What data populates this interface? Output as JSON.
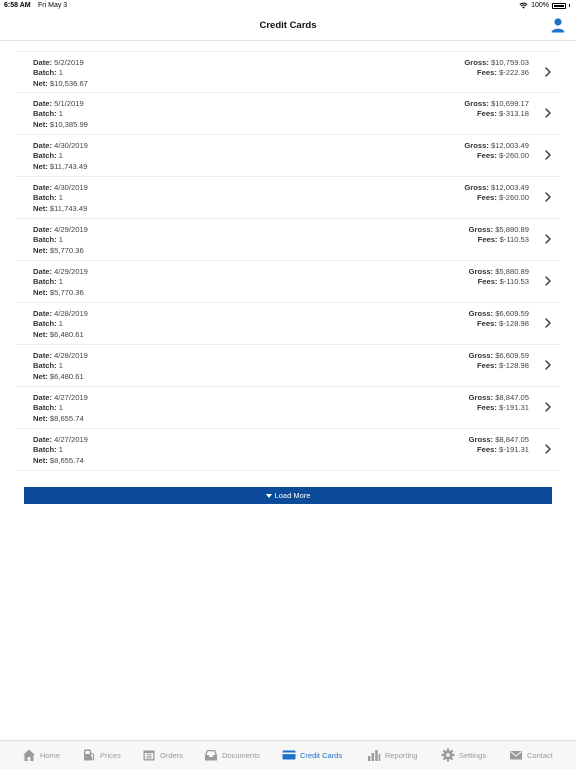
{
  "status": {
    "time": "6:58 AM",
    "date": "Fri May 3",
    "battery": "100%"
  },
  "nav": {
    "title": "Credit Cards"
  },
  "labels": {
    "date": "Date:",
    "batch": "Batch:",
    "net": "Net:",
    "gross": "Gross:",
    "fees": "Fees:"
  },
  "rows": [
    {
      "date": "5/2/2019",
      "batch": "1",
      "net": "$10,536.67",
      "gross": "$10,759.03",
      "fees": "$-222.36"
    },
    {
      "date": "5/1/2019",
      "batch": "1",
      "net": "$10,385.99",
      "gross": "$10,699.17",
      "fees": "$-313.18"
    },
    {
      "date": "4/30/2019",
      "batch": "1",
      "net": "$11,743.49",
      "gross": "$12,003.49",
      "fees": "$-260.00"
    },
    {
      "date": "4/30/2019",
      "batch": "1",
      "net": "$11,743.49",
      "gross": "$12,003.49",
      "fees": "$-260.00"
    },
    {
      "date": "4/29/2019",
      "batch": "1",
      "net": "$5,770.36",
      "gross": "$5,880.89",
      "fees": "$-110.53"
    },
    {
      "date": "4/29/2019",
      "batch": "1",
      "net": "$5,770.36",
      "gross": "$5,880.89",
      "fees": "$-110.53"
    },
    {
      "date": "4/28/2019",
      "batch": "1",
      "net": "$6,480.61",
      "gross": "$6,609.59",
      "fees": "$-128.98"
    },
    {
      "date": "4/28/2019",
      "batch": "1",
      "net": "$6,480.61",
      "gross": "$6,609.59",
      "fees": "$-128.98"
    },
    {
      "date": "4/27/2019",
      "batch": "1",
      "net": "$8,655.74",
      "gross": "$8,847.05",
      "fees": "$-191.31"
    },
    {
      "date": "4/27/2019",
      "batch": "1",
      "net": "$8,655.74",
      "gross": "$8,847.05",
      "fees": "$-191.31"
    }
  ],
  "load_more": {
    "label": "Load More"
  },
  "tabs": [
    {
      "id": "home",
      "label": "Home",
      "icon": "home-icon"
    },
    {
      "id": "prices",
      "label": "Prices",
      "icon": "fuel-pump-icon"
    },
    {
      "id": "orders",
      "label": "Orders",
      "icon": "calendar-icon"
    },
    {
      "id": "documents",
      "label": "Documents",
      "icon": "inbox-icon"
    },
    {
      "id": "credit-cards",
      "label": "Credit Cards",
      "icon": "credit-card-icon",
      "active": true
    },
    {
      "id": "reporting",
      "label": "Reporting",
      "icon": "bar-chart-icon"
    },
    {
      "id": "settings",
      "label": "Settings",
      "icon": "gear-icon"
    },
    {
      "id": "contact",
      "label": "Contact",
      "icon": "envelope-icon"
    }
  ],
  "colors": {
    "accent": "#1a73c9",
    "button": "#0c4b9a",
    "tab_inactive": "#999999"
  }
}
